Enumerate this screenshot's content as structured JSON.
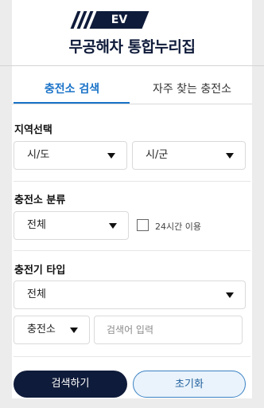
{
  "header": {
    "badge": "EV",
    "title": "무공해차 통합누리집"
  },
  "tabs": [
    {
      "label": "충전소 검색",
      "active": true
    },
    {
      "label": "자주 찾는 충전소",
      "active": false
    }
  ],
  "region": {
    "label": "지역선택",
    "province": "시/도",
    "city": "시/군"
  },
  "category": {
    "label": "충전소 분류",
    "value": "전체",
    "checkbox_label": "24시간 이용",
    "checkbox_checked": false
  },
  "charger_type": {
    "label": "충전기 타입",
    "value": "전체",
    "search_scope": "충전소",
    "search_placeholder": "검색어 입력"
  },
  "actions": {
    "search": "검색하기",
    "reset": "초기화"
  },
  "colors": {
    "navy": "#0f1b3a",
    "accent": "#1a73c8"
  }
}
